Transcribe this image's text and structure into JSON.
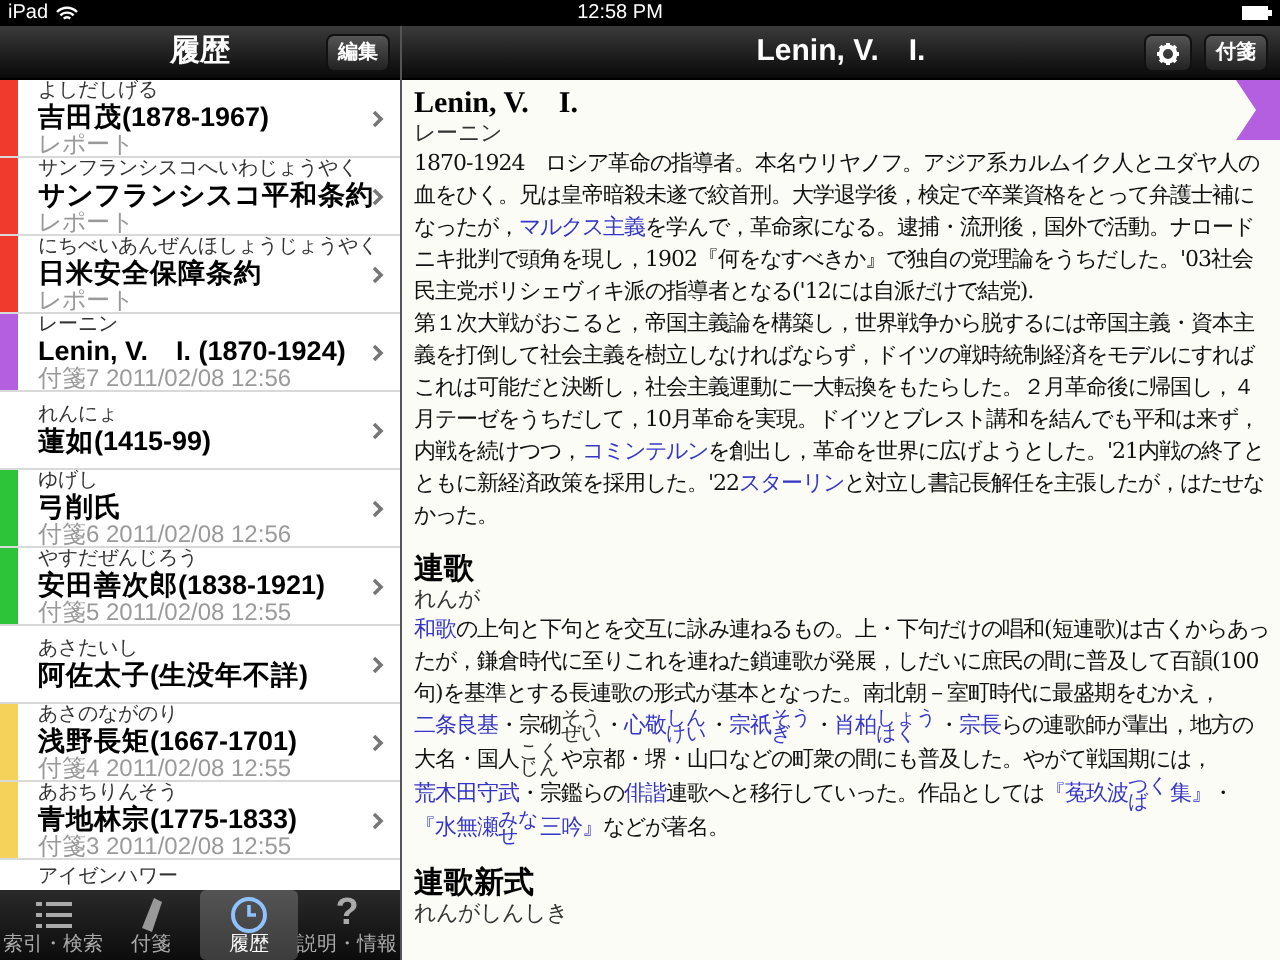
{
  "status_bar": {
    "device": "iPad",
    "time": "12:58 PM"
  },
  "sidebar": {
    "title": "履歴",
    "edit_button": "編集",
    "items": [
      {
        "reading": "よしだしげる",
        "title": "吉田茂(1878-1967)",
        "note": "レポート",
        "color": "#f03a2e"
      },
      {
        "reading": "サンフランシスコへいわじょうやく",
        "title": "サンフランシスコ平和条約",
        "note": "レポート",
        "color": "#f03a2e"
      },
      {
        "reading": "にちべいあんぜんほしょうじょうやく",
        "title": "日米安全保障条約",
        "note": "レポート",
        "color": "#f03a2e"
      },
      {
        "reading": "レーニン",
        "title": "Lenin, V.　I.  (1870-1924)",
        "note": "付箋7 2011/02/08 12:56",
        "color": "#b35fe0"
      },
      {
        "reading": "れんにょ",
        "title": "蓮如(1415-99)"
      },
      {
        "reading": "ゆげし",
        "title": "弓削氏",
        "note": "付箋6 2011/02/08 12:56",
        "color": "#2ec43a"
      },
      {
        "reading": "やすだぜんじろう",
        "title": "安田善次郎(1838-1921)",
        "note": "付箋5 2011/02/08 12:55",
        "color": "#2ec43a"
      },
      {
        "reading": "あさたいし",
        "title": "阿佐太子(生没年不詳)"
      },
      {
        "reading": "あさのながのり",
        "title": "浅野長矩(1667-1701)",
        "note": "付箋4 2011/02/08 12:55",
        "color": "#f5d25a"
      },
      {
        "reading": "あおちりんそう",
        "title": "青地林宗(1775-1833)",
        "note": "付箋3 2011/02/08 12:55",
        "color": "#f5d25a"
      },
      {
        "reading": "アイゼンハワー"
      }
    ]
  },
  "tab_bar": [
    {
      "label": "索引・検索",
      "selected": false
    },
    {
      "label": "付箋",
      "selected": false
    },
    {
      "label": "履歴",
      "selected": true
    },
    {
      "label": "説明・情報",
      "glyph": "?",
      "selected": false
    }
  ],
  "detail": {
    "title": "Lenin, V.　I.",
    "tag_button": "付箋",
    "entries": [
      {
        "heading": "Lenin, V.　I.",
        "reading": "レーニン",
        "paragraphs": [
          [
            {
              "kind": "plain",
              "text": "1870-1924　ロシア革命の指導者。本名ウリヤノフ。アジア系カルムイク人とユダヤ人の血をひく。兄は皇帝暗殺未遂で絞首刑。大学退学後，検定で卒業資格をとって弁護士補になったが，"
            },
            {
              "kind": "link",
              "text": "マルクス主義"
            },
            {
              "kind": "plain",
              "text": "を学んで，革命家になる。逮捕・流刑後，国外で活動。ナロードニキ批判で頭角を現し，1902『何をなすべきか』で独自の党理論をうちだした。'03社会民主党ボリシェヴィキ派の指導者となる('12には自派だけで結党)."
            }
          ],
          [
            {
              "kind": "plain",
              "text": "第１次大戦がおこると，帝国主義論を構築し，世界戦争から脱するには帝国主義・資本主義を打倒して社会主義を樹立しなければならず，ドイツの戦時統制経済をモデルにすればこれは可能だと決断し，社会主義運動に一大転換をもたらした。２月革命後に帰国し，４月テーゼをうちだして，10月革命を実現。ドイツとブレスト講和を結んでも平和は来ず，内戦を続けつつ，"
            },
            {
              "kind": "link",
              "text": "コミンテルン"
            },
            {
              "kind": "plain",
              "text": "を創出し，革命を世界に広げようとした。'21内戦の終了とともに新経済政策を採用した。'22"
            },
            {
              "kind": "link",
              "text": "スターリン"
            },
            {
              "kind": "plain",
              "text": "と対立し書記長解任を主張したが，はたせなかった。"
            }
          ]
        ]
      },
      {
        "heading": "連歌",
        "reading": "れんが",
        "paragraphs": [
          [
            {
              "kind": "link",
              "text": "和歌"
            },
            {
              "kind": "plain",
              "text": "の上句と下句とを交互に詠み連ねるもの。上・下句だけの唱和(短連歌)は古くからあったが，鎌倉時代に至りこれを連ねた鎖連歌が発展，しだいに庶民の間に普及して百韻(100句)を基準とする長連歌の形式が基本となった。南北朝－室町時代に最盛期をむかえ，"
            },
            {
              "kind": "link",
              "text": "二条良基"
            },
            {
              "kind": "plain",
              "text": "・宗砌"
            },
            {
              "kind": "reading",
              "text": "そうぜい"
            },
            {
              "kind": "plain",
              "text": "・"
            },
            {
              "kind": "link",
              "text": "心敬"
            },
            {
              "kind": "link_reading",
              "text": "しんけい"
            },
            {
              "kind": "plain",
              "text": "・"
            },
            {
              "kind": "link",
              "text": "宗祇"
            },
            {
              "kind": "link_reading",
              "text": "そうぎ"
            },
            {
              "kind": "plain",
              "text": "・"
            },
            {
              "kind": "link",
              "text": "肖柏"
            },
            {
              "kind": "link_reading",
              "text": "しょうはく"
            },
            {
              "kind": "plain",
              "text": "・"
            },
            {
              "kind": "link",
              "text": "宗長"
            },
            {
              "kind": "plain",
              "text": "らの連歌師が輩出，地方の大名・国人"
            },
            {
              "kind": "reading",
              "text": "こくじん"
            },
            {
              "kind": "plain",
              "text": "や京都・堺・山口などの町衆の間にも普及した。やがて戦国期には，"
            },
            {
              "kind": "link",
              "text": "荒木田守武"
            },
            {
              "kind": "plain",
              "text": "・宗鑑らの"
            },
            {
              "kind": "link",
              "text": "俳諧"
            },
            {
              "kind": "plain",
              "text": "連歌へと移行していった。作品としては"
            },
            {
              "kind": "link",
              "text": "『菟玖波"
            },
            {
              "kind": "link_reading",
              "text": "つくば"
            },
            {
              "kind": "link",
              "text": "集』"
            },
            {
              "kind": "plain",
              "text": "・"
            },
            {
              "kind": "link",
              "text": "『水無瀬"
            },
            {
              "kind": "link_reading",
              "text": "みなせ"
            },
            {
              "kind": "link",
              "text": "三吟』"
            },
            {
              "kind": "plain",
              "text": "などが著名。"
            }
          ]
        ]
      },
      {
        "heading": "連歌新式",
        "reading": "れんがしんしき"
      }
    ]
  }
}
